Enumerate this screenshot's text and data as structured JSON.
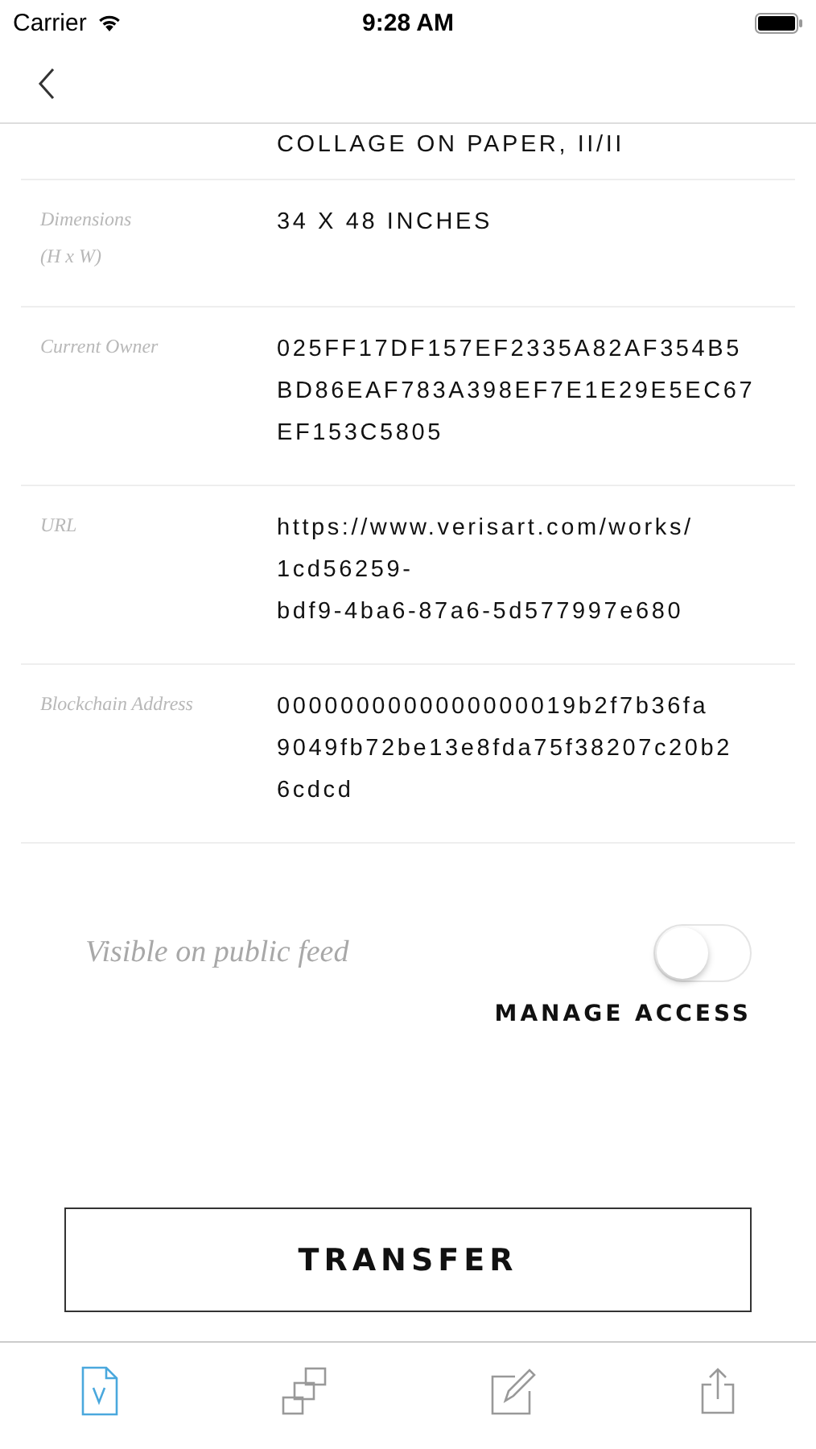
{
  "status_bar": {
    "carrier": "Carrier",
    "time": "9:28 AM"
  },
  "details": [
    {
      "value": "COLLAGE ON PAPER, II/II"
    },
    {
      "label": "Dimensions\n(H x W)",
      "value": "34 X 48 INCHES"
    },
    {
      "label": "Current Owner",
      "value": "025FF17DF157EF2335A82AF354B5\nBD86EAF783A398EF7E1E29E5EC67\nEF153C5805"
    },
    {
      "label": "URL",
      "value": "https://www.verisart.com/works/\n1cd56259-\nbdf9-4ba6-87a6-5d577997e680"
    },
    {
      "label": "Blockchain Address",
      "value": "0000000000000000019b2f7b36fa\n9049fb72be13e8fda75f38207c20b2\n6cdcd"
    }
  ],
  "public_feed": {
    "label": "Visible on public feed",
    "on": false
  },
  "manage_access": "MANAGE ACCESS",
  "transfer": "TRANSFER",
  "tabs": [
    {
      "kind": "certificate",
      "selected": true
    },
    {
      "kind": "layers",
      "selected": false
    },
    {
      "kind": "edit",
      "selected": false
    },
    {
      "kind": "share",
      "selected": false
    }
  ]
}
